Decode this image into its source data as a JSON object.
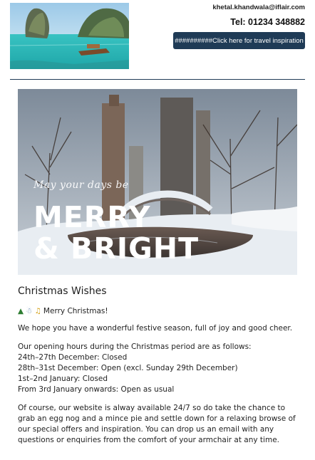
{
  "header": {
    "email": "khetal.khandwala@iflair.com",
    "phone": "Tel: 01234 348882",
    "cta_label": "##########Click here for travel inspiration"
  },
  "banner": {
    "script_text": "May your days be",
    "big_text_1": "MERRY",
    "big_text_2": "& BRIGHT"
  },
  "content": {
    "heading": "Christmas Wishes",
    "greeting_icons": [
      "tree-icon",
      "snowman-icon",
      "bell-icon"
    ],
    "greeting": "Merry Christmas!",
    "intro": "We hope you have a wonderful festive season, full of joy and good cheer.",
    "hours_intro": "Our opening hours during the Christmas period are as follows:",
    "hours": [
      "24th–27th December: Closed",
      "28th–31st December: Open (excl. Sunday 29th December)",
      "1st–2nd January: Closed",
      "From 3rd January onwards: Open as usual"
    ],
    "closing": "Of course, our website is alway available 24/7 so do take the chance to grab an egg nog and a mince pie and settle down for a relaxing browse of our special offers and inspiration. You can drop us an email with any questions or enquiries from the comfort of your armchair at any time."
  },
  "colors": {
    "accent": "#1f3b56",
    "text": "#222222"
  }
}
